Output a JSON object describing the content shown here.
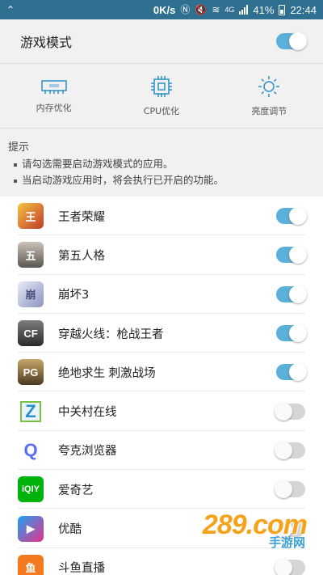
{
  "status_bar": {
    "speed": "0K/s",
    "network": "4G",
    "battery": "41%",
    "time": "22:44"
  },
  "header": {
    "title": "游戏模式",
    "enabled": true
  },
  "shortcuts": [
    {
      "label": "内存优化",
      "icon": "memory-icon"
    },
    {
      "label": "CPU优化",
      "icon": "cpu-icon"
    },
    {
      "label": "亮度调节",
      "icon": "brightness-icon"
    }
  ],
  "tips": {
    "title": "提示",
    "items": [
      "请勾选需要启动游戏模式的应用。",
      "当启动游戏应用时，将会执行已开启的功能。"
    ]
  },
  "apps": [
    {
      "name": "王者荣耀",
      "enabled": true,
      "color": "#c0392b",
      "glyph": "王"
    },
    {
      "name": "第五人格",
      "enabled": true,
      "color": "#6b6560",
      "glyph": "五"
    },
    {
      "name": "崩坏3",
      "enabled": true,
      "color": "#9aa6c8",
      "glyph": "崩"
    },
    {
      "name": "穿越火线：枪战王者",
      "enabled": true,
      "color": "#3a3a3a",
      "glyph": "CF"
    },
    {
      "name": "绝地求生 刺激战场",
      "enabled": true,
      "color": "#8a6d3b",
      "glyph": "PG"
    },
    {
      "name": "中关村在线",
      "enabled": false,
      "color": "#2a8fcf",
      "glyph": "Z"
    },
    {
      "name": "夸克浏览器",
      "enabled": false,
      "color": "#5b6ef5",
      "glyph": "Q"
    },
    {
      "name": "爱奇艺",
      "enabled": false,
      "color": "#00b30c",
      "glyph": "iQIY"
    },
    {
      "name": "优酷",
      "enabled": false,
      "color": "#1fa3f0",
      "glyph": "▶"
    },
    {
      "name": "斗鱼直播",
      "enabled": false,
      "color": "#f47a20",
      "glyph": "鱼"
    }
  ],
  "watermark": {
    "big": "289.com",
    "small": "手游网"
  },
  "colors": {
    "accent": "#5ab0d8",
    "status_bar": "#2f6f8f"
  }
}
